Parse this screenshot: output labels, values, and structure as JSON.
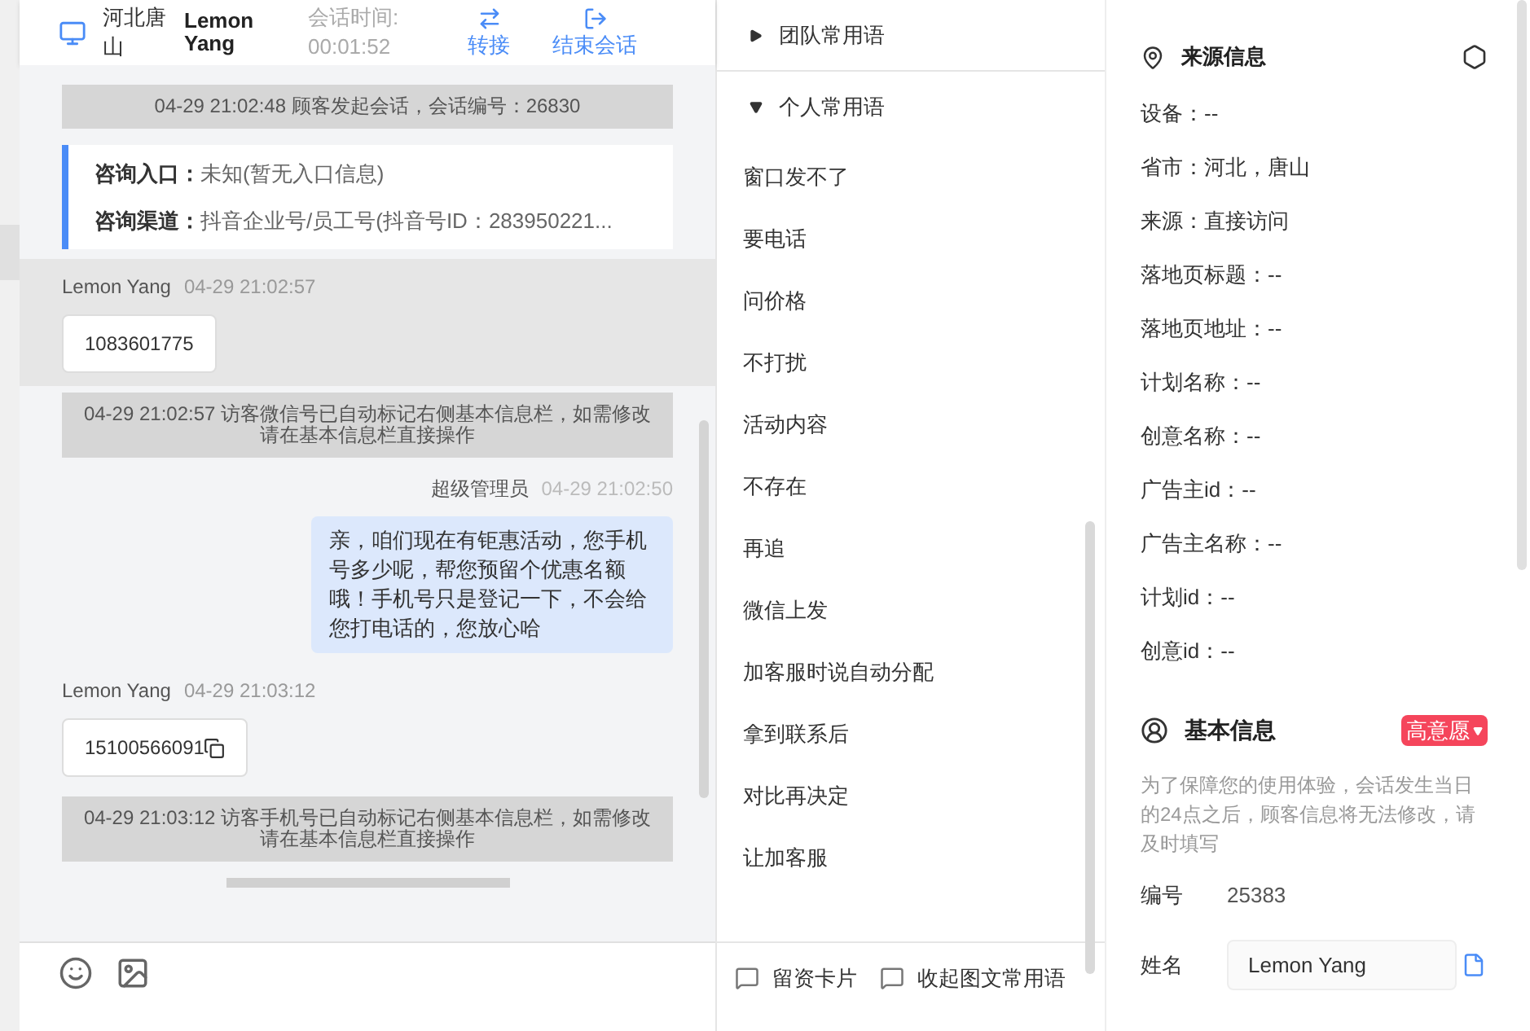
{
  "header": {
    "location": "河北唐山",
    "visitor": "Lemon Yang",
    "duration_label": "会话时间:",
    "duration": "00:01:52",
    "actions": [
      {
        "kind": "transfer",
        "label": "转接"
      },
      {
        "kind": "end",
        "label": "结束会话"
      }
    ]
  },
  "messages": [
    {
      "kind": "system",
      "text": "04-29 21:02:48 顾客发起会话，会话编号：26830"
    },
    {
      "kind": "info",
      "rows": [
        {
          "label": "咨询入口：",
          "value": "未知(暂无入口信息)"
        },
        {
          "label": "咨询渠道：",
          "value": "抖音企业号/员工号(抖音号ID：283950221..."
        }
      ]
    },
    {
      "kind": "visitor",
      "sender": "Lemon Yang",
      "time": "04-29 21:02:57",
      "text": "1083601775",
      "highlighted": true,
      "copy": false
    },
    {
      "kind": "system",
      "text": "04-29 21:02:57 访客微信号已自动标记右侧基本信息栏，如需修改请在基本信息栏直接操作"
    },
    {
      "kind": "agent",
      "sender": "超级管理员",
      "time": "04-29 21:02:50",
      "text": "亲，咱们现在有钜惠活动，您手机号多少呢，帮您预留个优惠名额哦！手机号只是登记一下，不会给您打电话的，您放心哈"
    },
    {
      "kind": "visitor",
      "sender": "Lemon Yang",
      "time": "04-29 21:03:12",
      "text": "15100566091",
      "highlighted": false,
      "copy": true
    },
    {
      "kind": "system",
      "text": "04-29 21:03:12 访客手机号已自动标记右侧基本信息栏，如需修改请在基本信息栏直接操作"
    }
  ],
  "quick_phrases": {
    "groups": [
      {
        "label": "团队常用语",
        "expanded": false
      },
      {
        "label": "个人常用语",
        "expanded": true
      }
    ],
    "items": [
      "窗口发不了",
      "要电话",
      "问价格",
      "不打扰",
      "活动内容",
      "不存在",
      "再追",
      "微信上发",
      "加客服时说自动分配",
      "拿到联系后",
      "对比再决定",
      "让加客服"
    ],
    "footer": [
      "留资卡片",
      "收起图文常用语"
    ]
  },
  "source_info": {
    "title": "来源信息",
    "fields": [
      "设备：--",
      "省市：河北，唐山",
      "来源：直接访问",
      "落地页标题：--",
      "落地页地址：--",
      "计划名称：--",
      "创意名称：--",
      "广告主id：--",
      "广告主名称：--",
      "计划id：--",
      "创意id：--"
    ]
  },
  "basic_info": {
    "title": "基本信息",
    "intent_tag": "高意愿",
    "notice": "为了保障您的使用体验，会话发生当日的24点之后，顾客信息将无法修改，请及时填写",
    "id_label": "编号",
    "id_value": "25383",
    "name_label": "姓名",
    "name_value": "Lemon Yang"
  }
}
